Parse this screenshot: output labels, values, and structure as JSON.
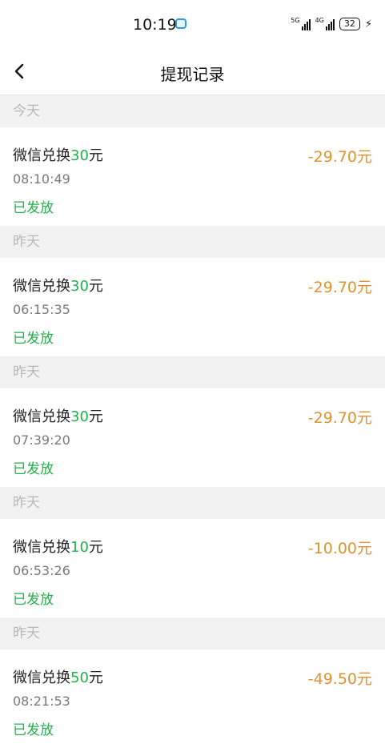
{
  "status_bar": {
    "time": "10:19",
    "net1": "5G",
    "net2": "4G",
    "battery": "32"
  },
  "nav": {
    "title": "提现记录"
  },
  "groups": [
    {
      "date_label": "今天",
      "record": {
        "title_prefix": "微信兑换",
        "title_amount": "30",
        "title_suffix": "元",
        "time": "08:10:49",
        "status": "已发放",
        "amount": "-29.70元"
      }
    },
    {
      "date_label": "昨天",
      "record": {
        "title_prefix": "微信兑换",
        "title_amount": "30",
        "title_suffix": "元",
        "time": "06:15:35",
        "status": "已发放",
        "amount": "-29.70元"
      }
    },
    {
      "date_label": "昨天",
      "record": {
        "title_prefix": "微信兑换",
        "title_amount": "30",
        "title_suffix": "元",
        "time": "07:39:20",
        "status": "已发放",
        "amount": "-29.70元"
      }
    },
    {
      "date_label": "昨天",
      "record": {
        "title_prefix": "微信兑换",
        "title_amount": "10",
        "title_suffix": "元",
        "time": "06:53:26",
        "status": "已发放",
        "amount": "-10.00元"
      }
    },
    {
      "date_label": "昨天",
      "record": {
        "title_prefix": "微信兑换",
        "title_amount": "50",
        "title_suffix": "元",
        "time": "08:21:53",
        "status": "已发放",
        "amount": "-49.50元"
      }
    }
  ],
  "colors": {
    "accent_green": "#22b14c",
    "amount_orange": "#e0922e",
    "background": "#f2f2f2"
  },
  "icons": {
    "back": "chevron-left-icon",
    "message": "message-icon",
    "charging": "bolt-icon"
  }
}
